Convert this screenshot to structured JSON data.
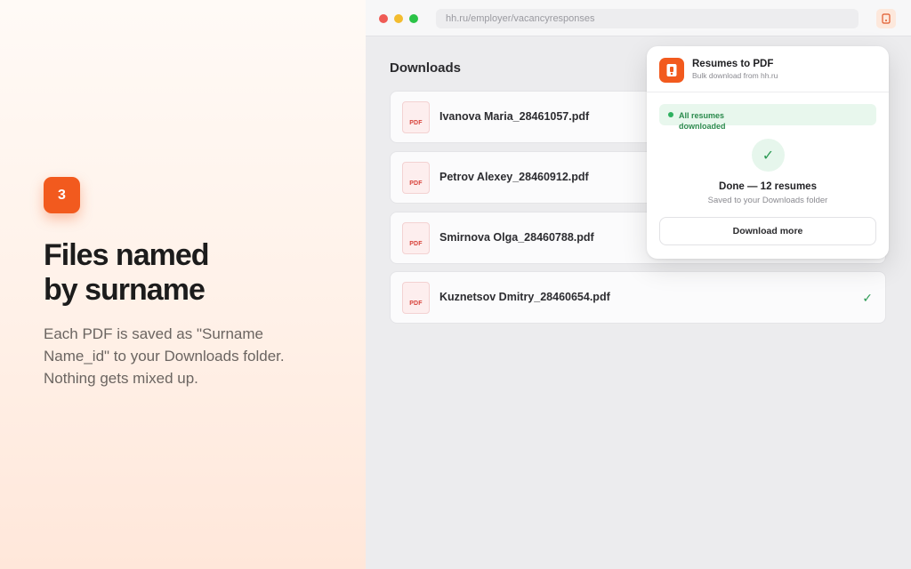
{
  "promo": {
    "step": "3",
    "headline_lines": [
      "Files named",
      "by surname"
    ],
    "subtext_lines": [
      "Each PDF is saved as \"Surname",
      "Name_id\" to your Downloads folder.",
      "Nothing gets mixed up."
    ]
  },
  "browser": {
    "url": "hh.ru/employer/vacancyresponses",
    "extension_icon": "pdf-extension-icon"
  },
  "downloads": {
    "title": "Downloads",
    "file_type_label": "PDF",
    "files": [
      {
        "name": "Ivanova Maria_28461057.pdf",
        "done": false
      },
      {
        "name": "Petrov Alexey_28460912.pdf",
        "done": false
      },
      {
        "name": "Smirnova Olga_28460788.pdf",
        "done": false
      },
      {
        "name": "Kuznetsov Dmitry_28460654.pdf",
        "done": true
      }
    ]
  },
  "popup": {
    "app_title": "Resumes to PDF",
    "app_subtitle": "Bulk download from hh.ru",
    "status": "All resumes downloaded",
    "done_title": "Done — 12 resumes",
    "done_subtitle": "Saved to your Downloads folder",
    "button_label": "Download more"
  },
  "colors": {
    "accent": "#f25a1e",
    "success": "#2c9a54",
    "pdf_red": "#d8443c"
  }
}
